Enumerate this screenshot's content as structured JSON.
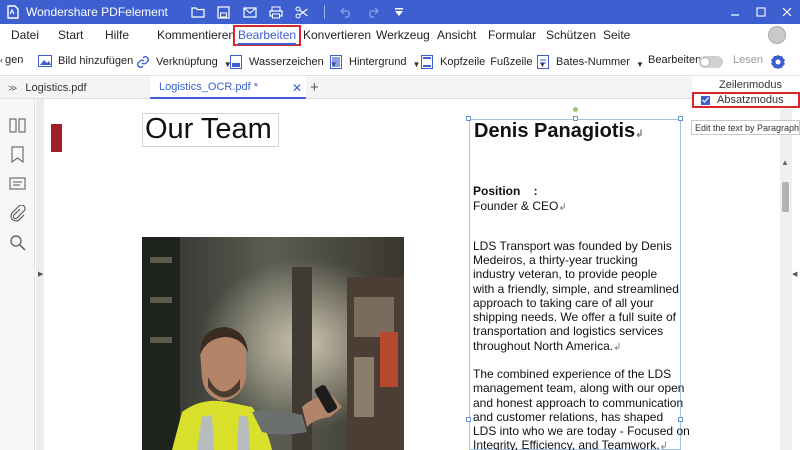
{
  "app": {
    "title": "Wondershare PDFelement"
  },
  "menu": {
    "items": [
      "Datei",
      "Start",
      "Hilfe",
      "Kommentieren",
      "Bearbeiten",
      "Konvertieren",
      "Werkzeug",
      "Ansicht",
      "Formular",
      "Schützen",
      "Seite"
    ],
    "active": "Bearbeiten"
  },
  "toolbar": {
    "prev_fragment": "gen",
    "add_image": "Bild hinzufügen",
    "link": "Verknüpfung",
    "watermark": "Wasserzeichen",
    "background": "Hintergrund",
    "header": "Kopfzeile",
    "footer": "Fußzeile",
    "bates": "Bates-Nummer",
    "edit": "Bearbeiten",
    "read": "Lesen"
  },
  "tabs": [
    {
      "label": "Logistics.pdf",
      "active": false
    },
    {
      "label": "Logistics_OCR.pdf *",
      "active": true
    }
  ],
  "edit_mode_menu": {
    "options": [
      "Zeilenmodus",
      "Absatzmodus"
    ],
    "selected": "Absatzmodus",
    "tooltip": "Edit the text by Paragraph"
  },
  "document": {
    "heading": "Our Team",
    "name": "Denis Panagiotis",
    "position_label": "Position    :",
    "position_value": "Founder & CEO",
    "para1": [
      "LDS Transport was founded by Denis",
      "Medeiros, a thirty-year trucking",
      "industry veteran, to provide people",
      "with a friendly, simple, and streamlined",
      "approach to taking care of all your",
      "shipping needs. We offer a full suite of",
      "transportation and logistics services",
      "throughout North America."
    ],
    "para2": [
      "The combined experience of the LDS",
      "management team, along with our open",
      "and honest approach to communication",
      "and customer relations, has shaped",
      "LDS into who we are today - Focused on",
      "Integrity, Efficiency, and Teamwork."
    ],
    "pilcrow": "↲"
  },
  "colors": {
    "brand": "#3d5fcf",
    "highlight": "#d9272e",
    "accent_mark": "#a01f2a"
  }
}
